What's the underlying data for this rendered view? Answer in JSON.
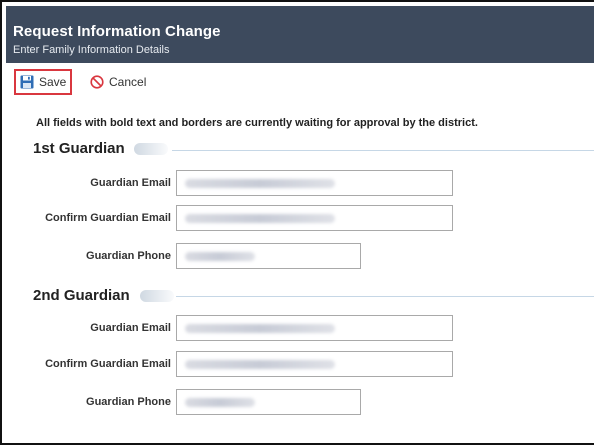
{
  "header": {
    "title": "Request Information Change",
    "subtitle": "Enter Family Information Details"
  },
  "toolbar": {
    "save_label": "Save",
    "cancel_label": "Cancel",
    "save_icon": "floppy-disk-icon",
    "cancel_icon": "prohibited-icon"
  },
  "notice": "All fields with bold text and borders are currently waiting for approval by the district.",
  "sections": [
    {
      "title": "1st Guardian",
      "fields": [
        {
          "label": "Guardian Email",
          "value": ""
        },
        {
          "label": "Confirm Guardian Email",
          "value": ""
        },
        {
          "label": "Guardian Phone",
          "value": ""
        }
      ]
    },
    {
      "title": "2nd Guardian",
      "fields": [
        {
          "label": "Guardian Email",
          "value": ""
        },
        {
          "label": "Confirm Guardian Email",
          "value": ""
        },
        {
          "label": "Guardian Phone",
          "value": ""
        }
      ]
    }
  ],
  "colors": {
    "header_bg": "#3d4a5d",
    "save_highlight": "#d9373f",
    "section_rule": "#c6d7e6"
  }
}
